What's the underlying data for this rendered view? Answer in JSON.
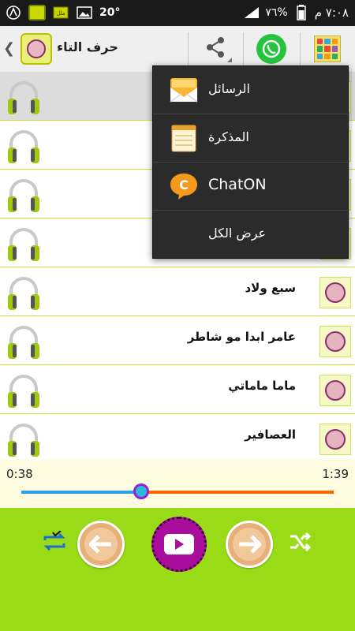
{
  "status_bar": {
    "temperature": "20°",
    "battery": "٧٦%",
    "time": "٧:٠٨ م"
  },
  "action_bar": {
    "title": "حرف التاء"
  },
  "share_menu": {
    "items": [
      {
        "label": "الرسائل",
        "icon": "messages-icon"
      },
      {
        "label": "المذكرة",
        "icon": "memo-icon"
      },
      {
        "label": "ChatON",
        "icon": "chaton-icon"
      },
      {
        "label": "عرض الكل",
        "icon": ""
      }
    ]
  },
  "songs": [
    {
      "title": ""
    },
    {
      "title": ""
    },
    {
      "title": ""
    },
    {
      "title": ""
    },
    {
      "title": "سبع ولاد"
    },
    {
      "title": "عامر ابدا مو شاطر"
    },
    {
      "title": "ماما ماماتي"
    },
    {
      "title": "العصافير"
    }
  ],
  "player": {
    "current_time": "0:38",
    "duration": "1:39",
    "progress": 0.385
  },
  "colors": {
    "accent_green": "#9adb18",
    "play_purple": "#a80d9c",
    "seek_played": "#2aa0e8",
    "seek_remaining": "#ff6a00"
  }
}
